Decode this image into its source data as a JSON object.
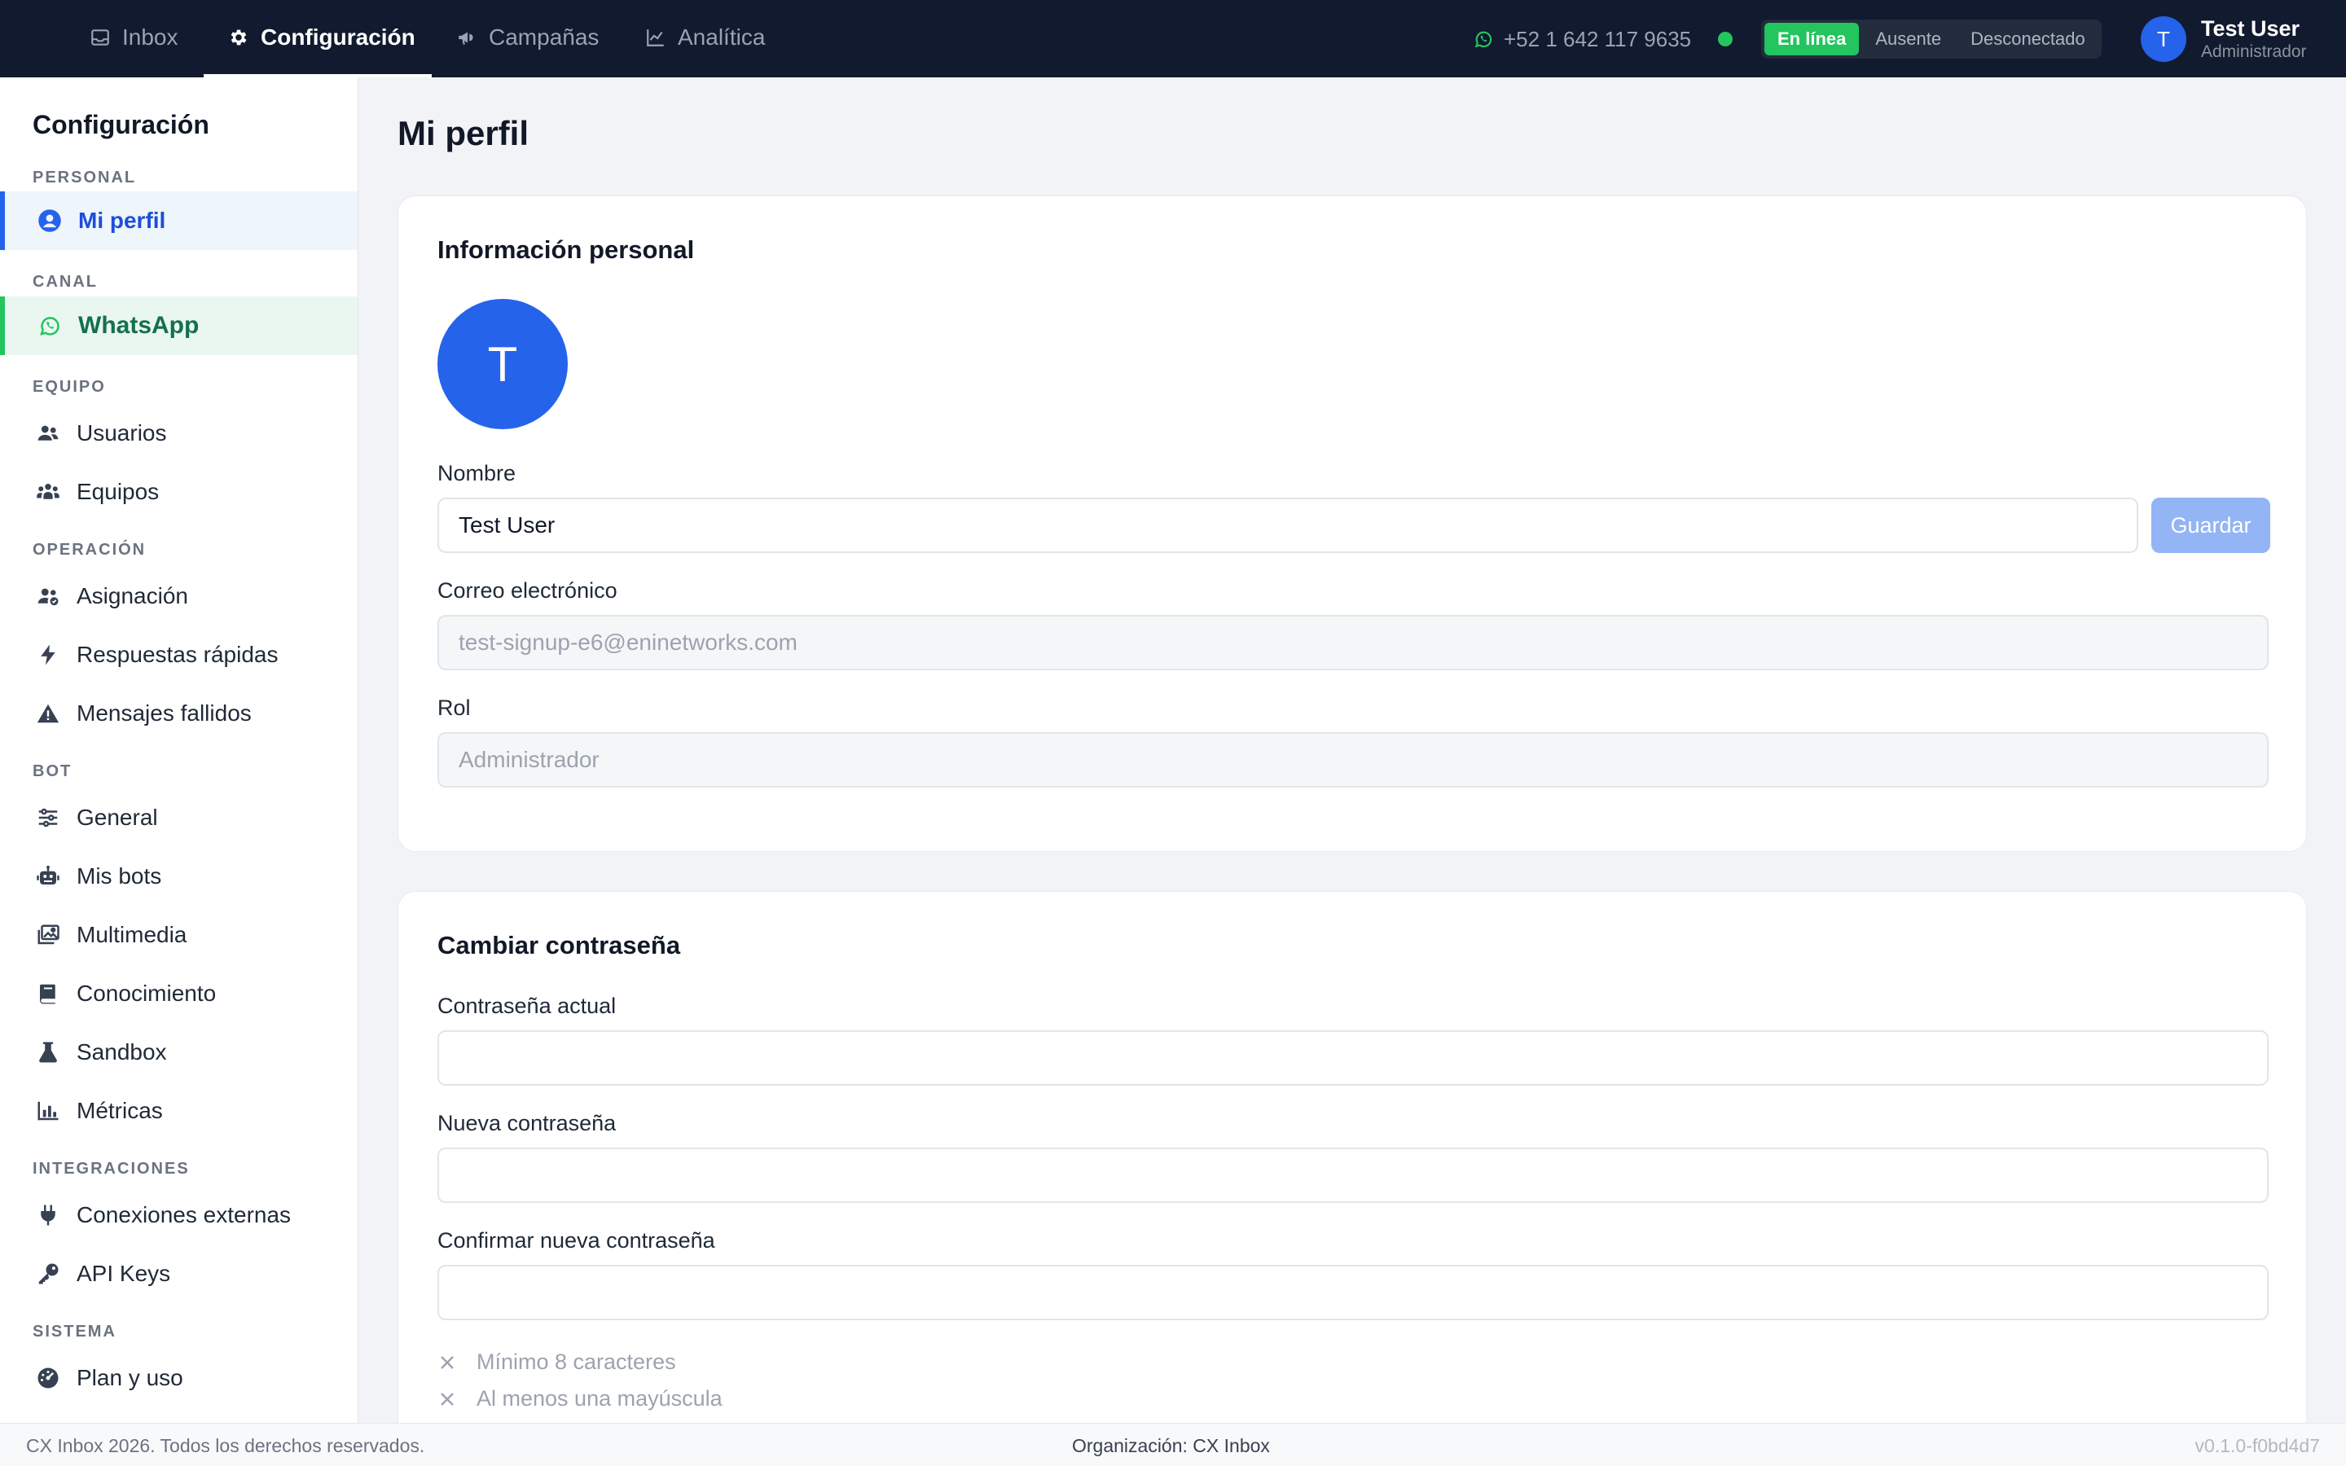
{
  "topbar": {
    "nav": [
      {
        "label": "Inbox",
        "icon": "inbox-icon"
      },
      {
        "label": "Configuración",
        "icon": "gear-icon",
        "active": true
      },
      {
        "label": "Campañas",
        "icon": "megaphone-icon"
      },
      {
        "label": "Analítica",
        "icon": "chart-line-icon"
      }
    ],
    "phone": "+52 1 642 117 9635",
    "status_options": [
      "En línea",
      "Ausente",
      "Desconectado"
    ],
    "status_selected": "En línea",
    "user": {
      "initial": "T",
      "name": "Test User",
      "role": "Administrador"
    }
  },
  "sidebar": {
    "title": "Configuración",
    "sections": {
      "personal": "PERSONAL",
      "canal": "CANAL",
      "equipo": "EQUIPO",
      "operacion": "OPERACIÓN",
      "bot": "BOT",
      "integraciones": "INTEGRACIONES",
      "sistema": "SISTEMA"
    },
    "items": {
      "mi_perfil": "Mi perfil",
      "whatsapp": "WhatsApp",
      "usuarios": "Usuarios",
      "equipos": "Equipos",
      "asignacion": "Asignación",
      "respuestas": "Respuestas rápidas",
      "mensajes": "Mensajes fallidos",
      "general": "General",
      "mis_bots": "Mis bots",
      "multimedia": "Multimedia",
      "conocimiento": "Conocimiento",
      "sandbox": "Sandbox",
      "metricas": "Métricas",
      "conexiones": "Conexiones externas",
      "api_keys": "API Keys",
      "plan": "Plan y uso"
    }
  },
  "main": {
    "page_title": "Mi perfil",
    "personal": {
      "title": "Información personal",
      "avatar_initial": "T",
      "name_label": "Nombre",
      "name_value": "Test User",
      "save_label": "Guardar",
      "email_label": "Correo electrónico",
      "email_value": "test-signup-e6@eninetworks.com",
      "role_label": "Rol",
      "role_value": "Administrador"
    },
    "password": {
      "title": "Cambiar contraseña",
      "current_label": "Contraseña actual",
      "new_label": "Nueva contraseña",
      "confirm_label": "Confirmar nueva contraseña",
      "requirements": [
        "Mínimo 8 caracteres",
        "Al menos una mayúscula"
      ]
    }
  },
  "footer": {
    "copyright": "CX Inbox 2026. Todos los derechos reservados.",
    "organization": "Organización: CX Inbox",
    "version": "v0.1.0-f0bd4d7"
  },
  "colors": {
    "topbar": "#111a2e",
    "accent_blue": "#2563eb",
    "accent_green": "#22c55e"
  }
}
